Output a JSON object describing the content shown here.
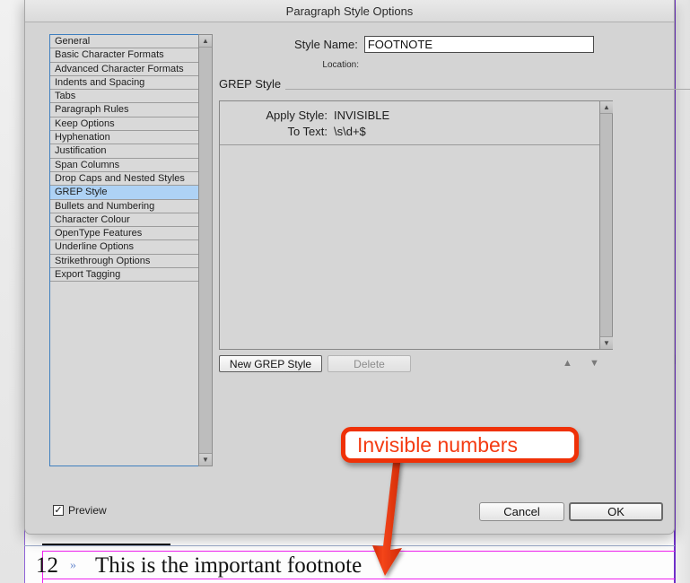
{
  "dialog": {
    "title": "Paragraph Style Options",
    "style_name": {
      "label": "Style Name:",
      "value": "FOOTNOTE"
    },
    "location": {
      "label": "Location:",
      "value": ""
    },
    "sidebar": {
      "items": [
        {
          "label": "General",
          "selected": false
        },
        {
          "label": "Basic Character Formats",
          "selected": false
        },
        {
          "label": "Advanced Character Formats",
          "selected": false
        },
        {
          "label": "Indents and Spacing",
          "selected": false
        },
        {
          "label": "Tabs",
          "selected": false
        },
        {
          "label": "Paragraph Rules",
          "selected": false
        },
        {
          "label": "Keep Options",
          "selected": false
        },
        {
          "label": "Hyphenation",
          "selected": false
        },
        {
          "label": "Justification",
          "selected": false
        },
        {
          "label": "Span Columns",
          "selected": false
        },
        {
          "label": "Drop Caps and Nested Styles",
          "selected": false
        },
        {
          "label": "GREP Style",
          "selected": true
        },
        {
          "label": "Bullets and Numbering",
          "selected": false
        },
        {
          "label": "Character Colour",
          "selected": false
        },
        {
          "label": "OpenType Features",
          "selected": false
        },
        {
          "label": "Underline Options",
          "selected": false
        },
        {
          "label": "Strikethrough Options",
          "selected": false
        },
        {
          "label": "Export Tagging",
          "selected": false
        }
      ]
    },
    "grep_panel": {
      "heading": "GREP Style",
      "rows": [
        {
          "apply_style_label": "Apply Style:",
          "apply_style_value": "INVISIBLE",
          "to_text_label": "To Text:",
          "to_text_value": "\\s\\d+$"
        }
      ],
      "new_button": "New GREP Style",
      "delete_button": "Delete",
      "move_up_icon": "▲",
      "move_down_icon": "▼"
    },
    "footer": {
      "preview_label": "Preview",
      "preview_checked": true,
      "check_glyph": "✓",
      "cancel_button": "Cancel",
      "ok_button": "OK"
    }
  },
  "annotation": {
    "callout_text": "Invisible numbers",
    "callout_border_color": "#ef3108",
    "callout_text_color": "#f43b12",
    "arrow_color": "#e8330a"
  },
  "document": {
    "footnote_number": "12",
    "footnote_marker": "»",
    "footnote_text": "This is the important footnote",
    "text_cursor_glyph": "⌷",
    "page_edge_color": "#6e30c8",
    "frame_color": "#ef22ef"
  },
  "scrollbars": {
    "up_arrow": "▲",
    "down_arrow": "▼"
  }
}
